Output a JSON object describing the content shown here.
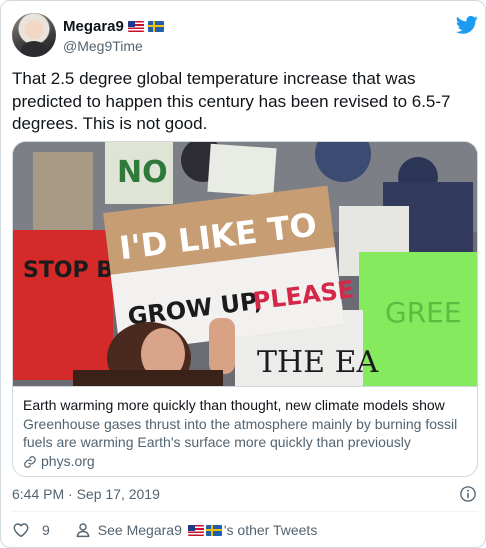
{
  "author": {
    "display_name": "Megara9",
    "handle": "@Meg9Time",
    "flags": [
      "us-flag",
      "sweden-flag"
    ]
  },
  "tweet": {
    "text": "That 2.5 degree global temperature increase that was predicted to happen this century has been revised to 6.5-7 degrees. This is not good."
  },
  "link_card": {
    "image_alt": "Climate protest photo with signs",
    "image_signs": {
      "main_sign_line1": "I'D LIKE TO",
      "main_sign_line2a": "GROW UP,",
      "main_sign_line2b": "PLEASE",
      "left_sign": "STOP BURNING",
      "bottom_sign": "THE EA",
      "top_sign": "NO",
      "green_sign": "GREE"
    },
    "title": "Earth warming more quickly than thought, new climate models show",
    "description": "Greenhouse gases thrust into the atmosphere mainly by burning fossil fuels are warming Earth's surface more quickly than previously understoo...",
    "domain": "phys.org"
  },
  "meta": {
    "timestamp": "6:44 PM · Sep 17, 2019"
  },
  "actions": {
    "like_count": "9",
    "see_label_prefix": "See Megara9",
    "see_label_suffix": "'s other Tweets"
  },
  "colors": {
    "twitter_blue": "#1d9bf0",
    "text_primary": "#0f1419",
    "text_secondary": "#536471",
    "border": "#cfd9de"
  }
}
